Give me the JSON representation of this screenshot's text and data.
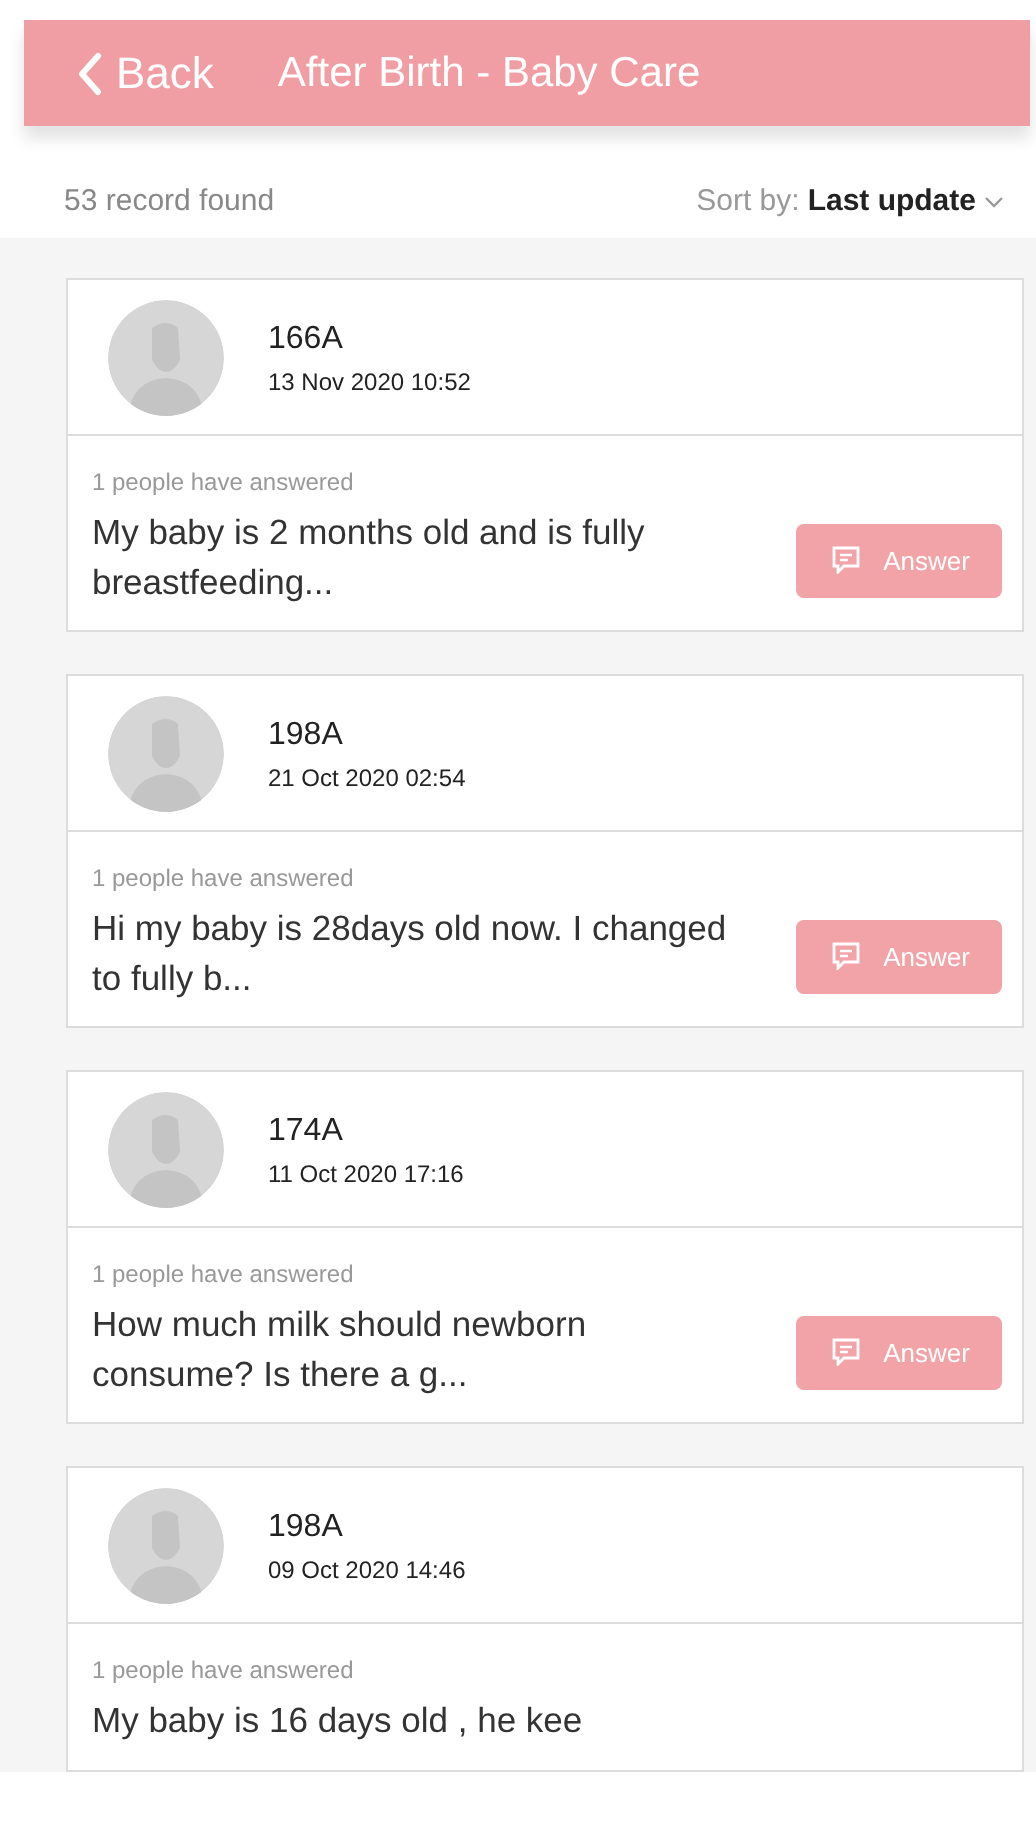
{
  "header": {
    "back_label": "Back",
    "title": "After Birth - Baby Care"
  },
  "summary": {
    "count": "53 record found",
    "sort_label": "Sort by:",
    "sort_value": "Last update"
  },
  "posts": [
    {
      "author": "166A",
      "date": "13 Nov 2020 10:52",
      "answers": "1 people have answered",
      "question": "My baby is 2 months old and is fully breastfeeding...",
      "button": "Answer"
    },
    {
      "author": "198A",
      "date": "21 Oct 2020 02:54",
      "answers": "1 people have answered",
      "question": "Hi my baby is 28days old now. I changed to fully b...",
      "button": "Answer"
    },
    {
      "author": "174A",
      "date": "11 Oct 2020 17:16",
      "answers": "1 people have answered",
      "question": "How much milk should newborn consume? Is there a g...",
      "button": "Answer"
    },
    {
      "author": "198A",
      "date": "09 Oct 2020 14:46",
      "answers": "1 people have answered",
      "question": "My baby is 16 days old , he kee"
    }
  ]
}
